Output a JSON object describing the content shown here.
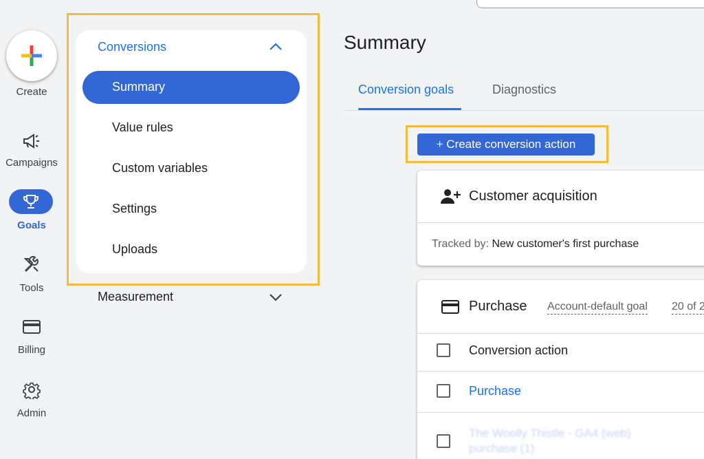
{
  "rail": {
    "create_label": "Create",
    "items": [
      {
        "label": "Campaigns",
        "icon": "megaphone-icon"
      },
      {
        "label": "Goals",
        "icon": "trophy-icon"
      },
      {
        "label": "Tools",
        "icon": "tools-icon"
      },
      {
        "label": "Billing",
        "icon": "credit-card-icon"
      },
      {
        "label": "Admin",
        "icon": "gear-icon"
      }
    ]
  },
  "nav": {
    "section": "Conversions",
    "items": [
      "Summary",
      "Value rules",
      "Custom variables",
      "Settings",
      "Uploads"
    ],
    "active": "Summary",
    "measurement": "Measurement"
  },
  "main": {
    "title": "Summary",
    "tabs": [
      {
        "label": "Conversion goals",
        "active": true
      },
      {
        "label": "Diagnostics",
        "active": false
      }
    ],
    "create_button": "+ Create conversion action",
    "customer_card": {
      "title": "Customer acquisition",
      "tracked_prefix": "Tracked by:",
      "tracked_value": "New customer's first purchase"
    },
    "purchase_card": {
      "title": "Purchase",
      "goal_badge": "Account-default goal",
      "count_partial": "20 of 2",
      "header": "Conversion action",
      "rows": [
        "Purchase",
        "The Woolly Thistle - GA4 (web) purchase (1)"
      ]
    }
  },
  "colors": {
    "accent": "#1a73e8",
    "active_fill": "#3367d6",
    "highlight": "#f6b93b"
  }
}
